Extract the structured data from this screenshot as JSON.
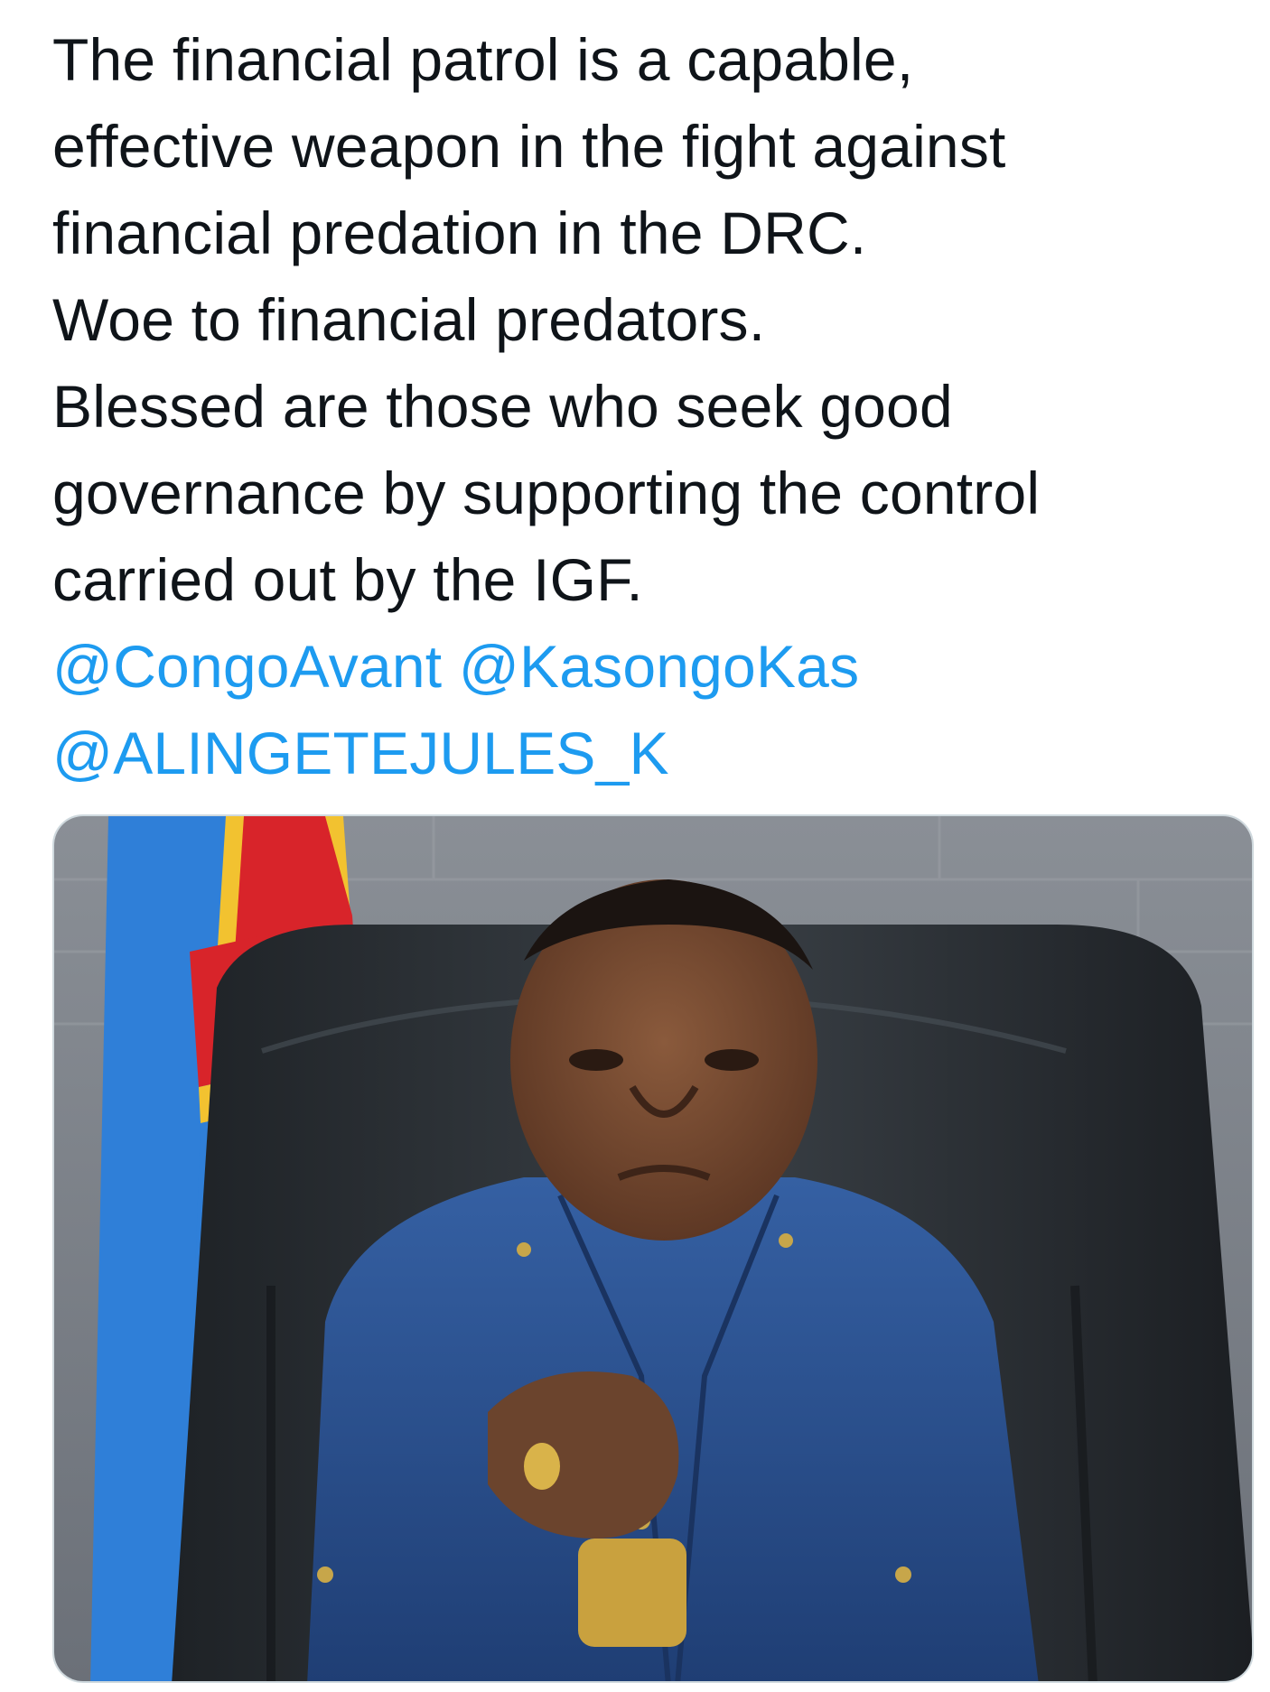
{
  "tweet": {
    "text_lines": [
      "The financial patrol is a capable,",
      "effective weapon in the fight against",
      "financial predation in the DRC.",
      "Woe to financial predators.",
      "Blessed are those who seek good",
      "governance by supporting the control",
      "carried out by the IGF."
    ],
    "mentions": {
      "first": "@CongoAvant",
      "second": "@KasongoKas",
      "third": "@ALINGETEJULES_K"
    },
    "mention_color": "#1d9bf0",
    "text_color": "#0f1419"
  },
  "media": {
    "flag_colors": {
      "blue": "#2f7fd8",
      "yellow": "#f2c230",
      "red": "#d8242a"
    },
    "suit_color": "#2a4f8f"
  }
}
